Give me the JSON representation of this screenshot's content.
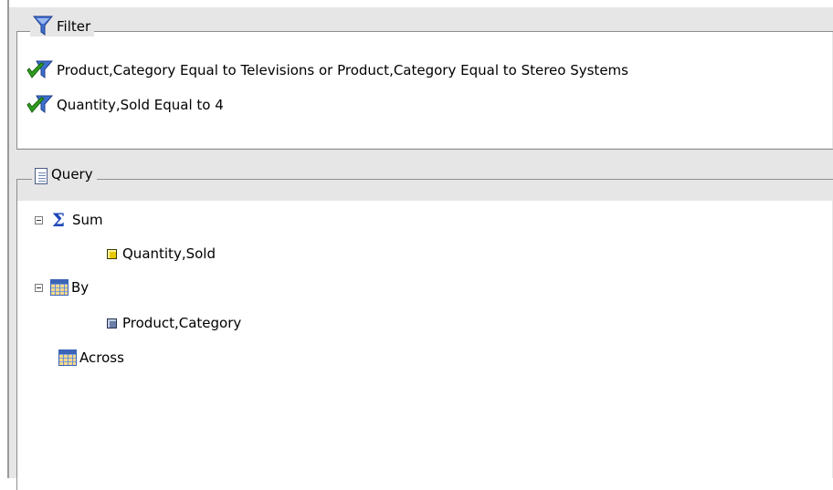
{
  "filter": {
    "title": "Filter",
    "icon": "funnel-icon",
    "conditions": [
      "Product,Category Equal to Televisions or Product,Category Equal to Stereo Systems",
      "Quantity,Sold Equal to 4"
    ]
  },
  "query": {
    "title": "Query",
    "icon": "document-icon",
    "tree": {
      "sum": {
        "label": "Sum",
        "children": [
          "Quantity,Sold"
        ]
      },
      "by": {
        "label": "By",
        "children": [
          "Product,Category"
        ]
      },
      "across": {
        "label": "Across"
      }
    }
  },
  "colors": {
    "panel_background": "#e6e6e6",
    "frame_border": "#8e8e8e",
    "sigma": "#1d47b8",
    "check_green": "#2f9e1e",
    "funnel_blue": "#3d6fd0"
  }
}
